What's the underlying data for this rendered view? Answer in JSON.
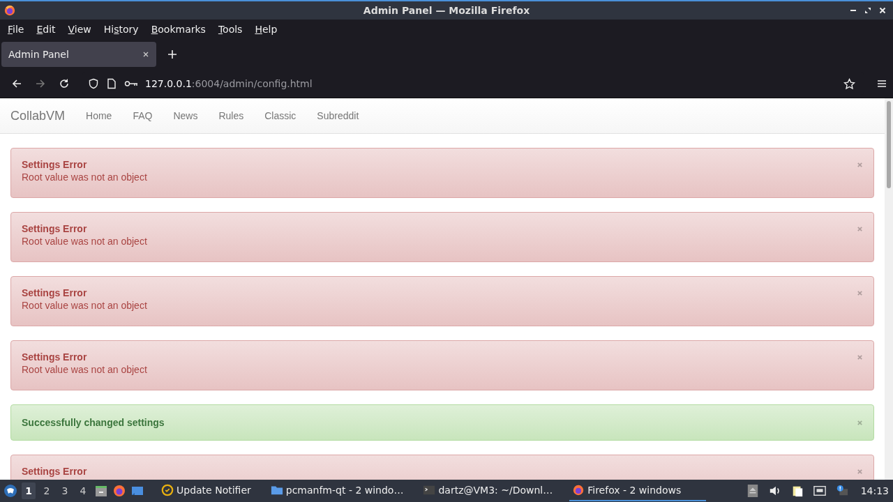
{
  "window": {
    "title": "Admin Panel — Mozilla Firefox"
  },
  "menu": [
    {
      "key": "F",
      "rest": "ile"
    },
    {
      "key": "E",
      "rest": "dit"
    },
    {
      "key": "V",
      "rest": "iew"
    },
    {
      "before": "Hi",
      "key": "s",
      "rest": "tory"
    },
    {
      "key": "B",
      "rest": "ookmarks"
    },
    {
      "key": "T",
      "rest": "ools"
    },
    {
      "key": "H",
      "rest": "elp"
    }
  ],
  "tabs": [
    {
      "label": "Admin Panel",
      "selected": true
    }
  ],
  "url": {
    "host": "127.0.0.1",
    "rest": ":6004/admin/config.html"
  },
  "navbar": {
    "brand": "CollabVM",
    "links": [
      "Home",
      "FAQ",
      "News",
      "Rules",
      "Classic",
      "Subreddit"
    ]
  },
  "alerts": [
    {
      "kind": "error",
      "title": "Settings Error",
      "message": "Root value was not an object"
    },
    {
      "kind": "error",
      "title": "Settings Error",
      "message": "Root value was not an object"
    },
    {
      "kind": "error",
      "title": "Settings Error",
      "message": "Root value was not an object"
    },
    {
      "kind": "error",
      "title": "Settings Error",
      "message": "Root value was not an object"
    },
    {
      "kind": "success",
      "title": "Successfully changed settings"
    },
    {
      "kind": "error",
      "title": "Settings Error"
    }
  ],
  "taskbar": {
    "workspaces": [
      {
        "label": "1",
        "selected": true
      },
      {
        "label": "2",
        "selected": false
      },
      {
        "label": "3",
        "selected": false
      },
      {
        "label": "4",
        "selected": false
      }
    ],
    "tasks": [
      {
        "kind": "notifier",
        "label": "Update Notifier",
        "selected": false
      },
      {
        "kind": "folder",
        "label": "pcmanfm-qt - 2 windo…",
        "selected": false
      },
      {
        "kind": "terminal",
        "label": "dartz@VM3: ~/Downl…",
        "selected": false
      },
      {
        "kind": "firefox",
        "label": "Firefox - 2 windows",
        "selected": true
      }
    ],
    "clock": "14:13"
  }
}
